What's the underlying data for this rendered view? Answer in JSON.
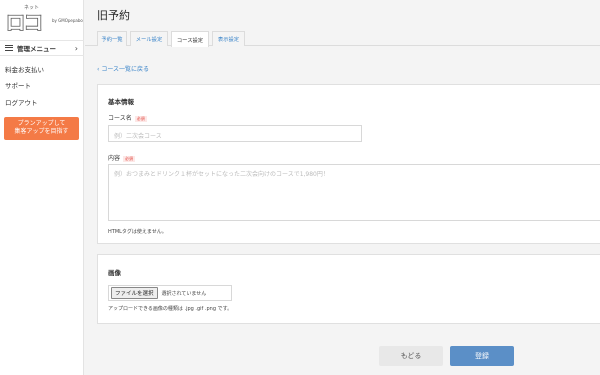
{
  "sidebar": {
    "logo_text": "ロコ",
    "logo_byline": "by GMOpepabo",
    "logo_small": "ネット",
    "menu_header": "管理メニュー",
    "links": [
      "料金お支払い",
      "サポート",
      "ログアウト"
    ],
    "upgrade_line1": "プランアップして",
    "upgrade_line2": "集客アップを目指す"
  },
  "header": {
    "title": "旧予約"
  },
  "tabs": [
    {
      "label": "予約一覧",
      "active": false
    },
    {
      "label": "メール設定",
      "active": false
    },
    {
      "label": "コース設定",
      "active": true
    },
    {
      "label": "表示設定",
      "active": false
    }
  ],
  "main": {
    "back_link": "コース一覧に戻る",
    "basic": {
      "title": "基本情報",
      "name_label": "コース名",
      "required": "必須",
      "name_placeholder": "例）二次会コース",
      "content_label": "内容",
      "content_placeholder": "例）おつまみとドリンク１杯がセットになった二次会向けのコースで1,980円！",
      "html_note": "HTMLタグは使えません。"
    },
    "image": {
      "title": "画像",
      "file_button": "ファイルを選択",
      "file_status": "選択されていません",
      "types_note": "アップロードできる画像の種類は .jpg .gif .png です。"
    }
  },
  "actions": {
    "back": "もどる",
    "submit": "登録"
  }
}
